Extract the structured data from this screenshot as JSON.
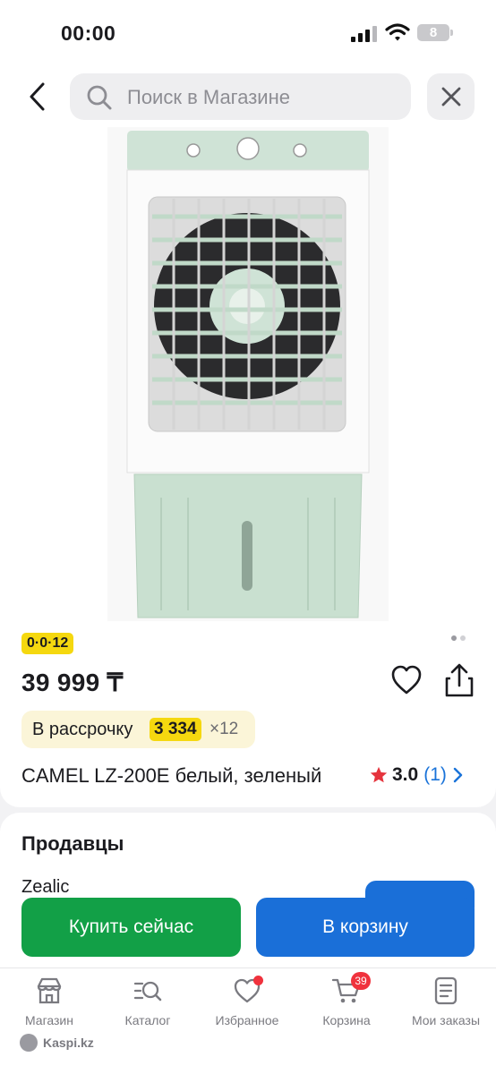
{
  "status_bar": {
    "time": "00:00",
    "battery": "8"
  },
  "search": {
    "placeholder": "Поиск в Магазине"
  },
  "product": {
    "badge": "0·0·12",
    "price": "39 999 ₸",
    "installment_label": "В рассрочку",
    "installment_amount": "3 334",
    "installment_months": "×12",
    "name": "CAMEL LZ-200E белый, зеленый",
    "rating": "3.0",
    "review_count": "(1)",
    "image_pages_total": 2,
    "image_page_current": 1
  },
  "sellers": {
    "title": "Продавцы",
    "first_seller_peek": "Zealic"
  },
  "actions": {
    "buy_now": "Купить сейчас",
    "add_to_cart": "В корзину"
  },
  "tab_bar": {
    "items": [
      {
        "label": "Магазин",
        "icon": "store-icon"
      },
      {
        "label": "Каталог",
        "icon": "catalog-search-icon"
      },
      {
        "label": "Избранное",
        "icon": "heart-icon"
      },
      {
        "label": "Корзина",
        "icon": "cart-icon"
      },
      {
        "label": "Мои заказы",
        "icon": "orders-icon"
      }
    ],
    "cart_count": "39"
  },
  "watermark": "Kaspi.kz",
  "colors": {
    "accent_blue": "#1a6fd8",
    "buy_green": "#12a047",
    "badge_yellow": "#f5d80f",
    "installment_bg": "#fbf5d8",
    "star_red": "#e5343d",
    "notification_red": "#f0323d"
  }
}
